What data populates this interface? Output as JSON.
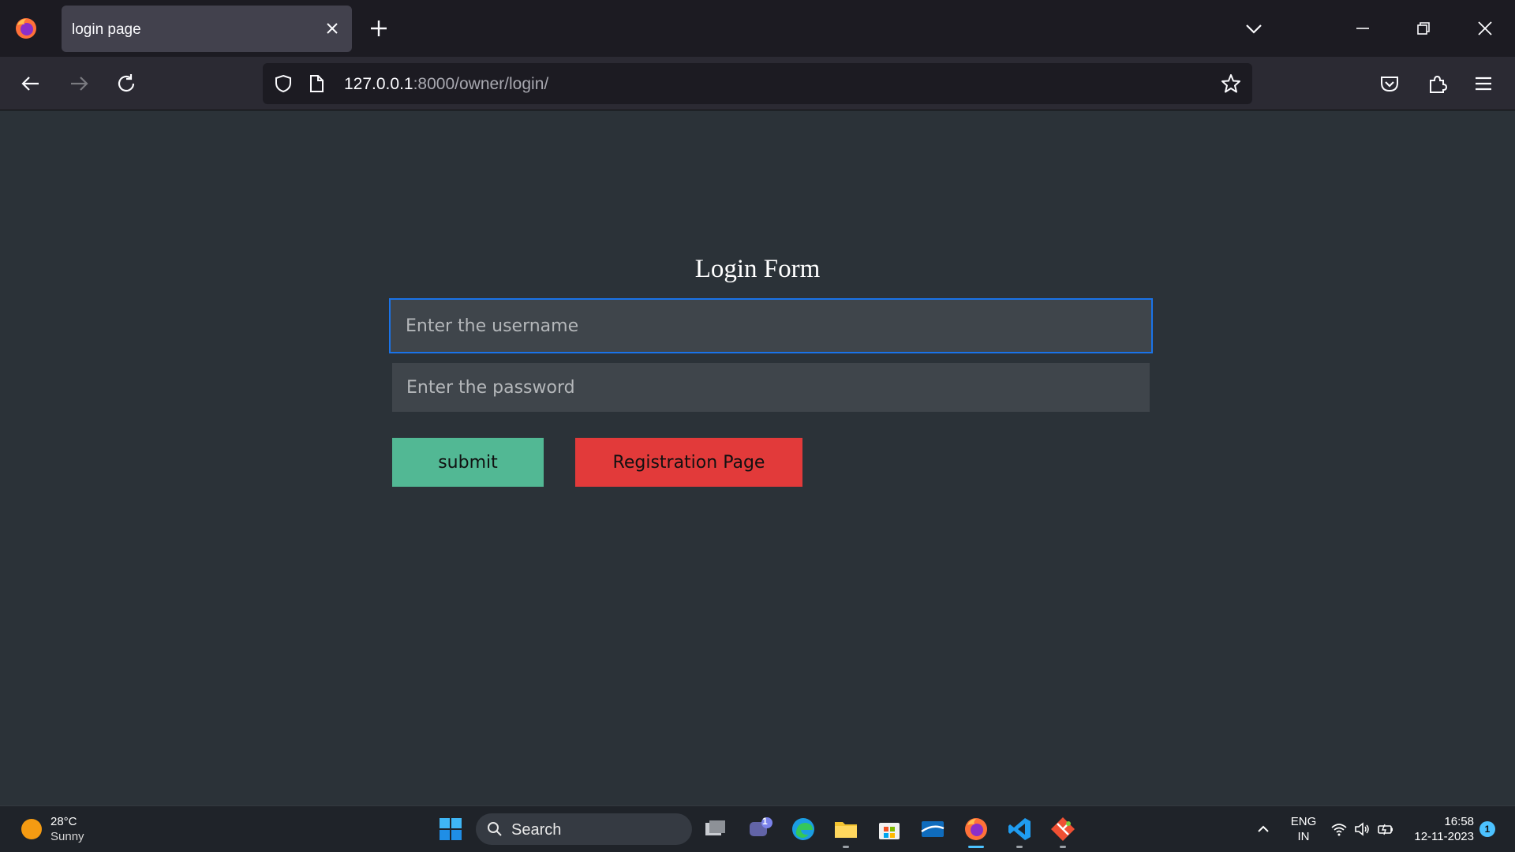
{
  "browser": {
    "tab": {
      "title": "login page"
    },
    "url": {
      "host": "127.0.0.1",
      "path": ":8000/owner/login/"
    }
  },
  "form": {
    "title": "Login Form",
    "username_placeholder": "Enter the username",
    "password_placeholder": "Enter the password",
    "submit_label": "submit",
    "register_label": "Registration Page"
  },
  "taskbar": {
    "weather": {
      "temp": "28°C",
      "desc": "Sunny"
    },
    "search_label": "Search",
    "chat_badge": "1",
    "lang": {
      "line1": "ENG",
      "line2": "IN"
    },
    "clock": {
      "time": "16:58",
      "date": "12-11-2023"
    },
    "notification_count": "1"
  },
  "colors": {
    "page_bg": "#2b3238",
    "submit": "#52b894",
    "register": "#e23a3a",
    "focus_ring": "#1a73e8"
  }
}
